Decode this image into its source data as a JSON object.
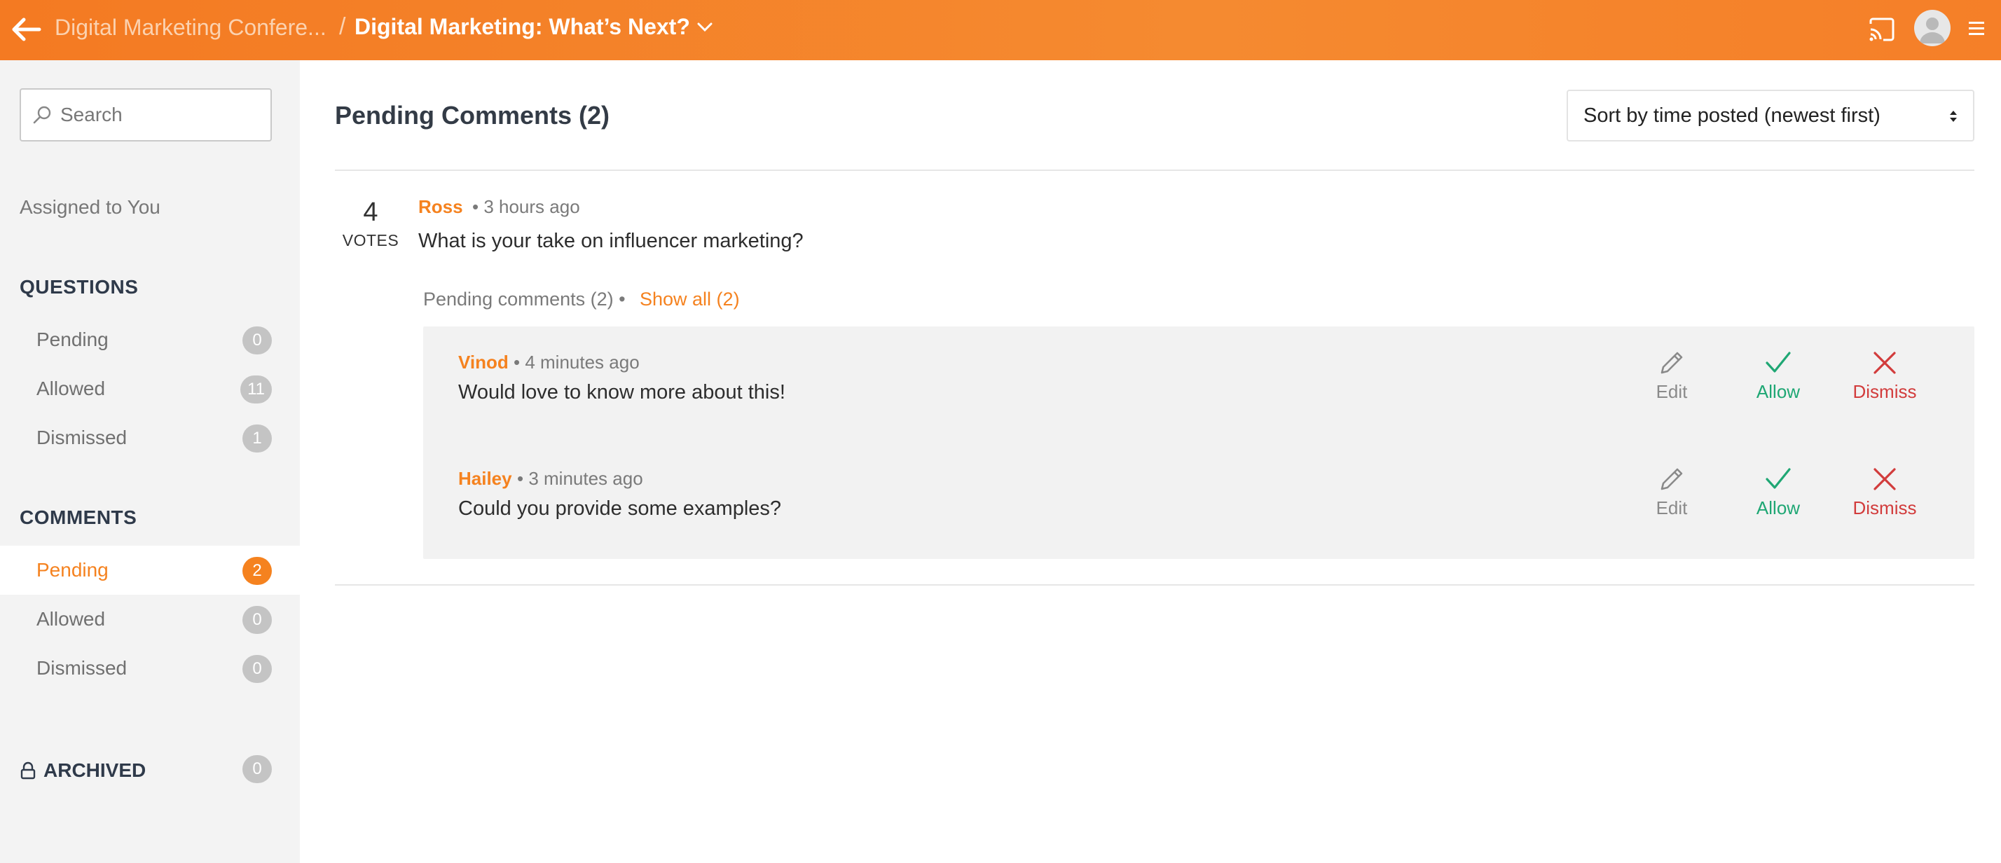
{
  "header": {
    "parent_title": "Digital Marketing Confere...",
    "separator": "/",
    "current_title": "Digital Marketing: What’s Next?"
  },
  "colors": {
    "accent": "#f5821f",
    "allow": "#1fa774",
    "dismiss": "#d23c3c",
    "sidebar_bg": "#f3f3f3",
    "panel_bg": "#f2f2f2"
  },
  "icons": [
    "back-arrow-icon",
    "chevron-down-icon",
    "cast-icon",
    "user-avatar-icon",
    "hamburger-menu-icon",
    "search-icon",
    "lock-icon",
    "pencil-icon",
    "checkmark-icon",
    "close-x-icon",
    "sort-arrows-icon"
  ],
  "sidebar": {
    "search_placeholder": "Search",
    "assigned": "Assigned to You",
    "questions": {
      "title": "QUESTIONS",
      "items": [
        {
          "label": "Pending",
          "count": "0"
        },
        {
          "label": "Allowed",
          "count": "11"
        },
        {
          "label": "Dismissed",
          "count": "1"
        }
      ]
    },
    "comments": {
      "title": "COMMENTS",
      "items": [
        {
          "label": "Pending",
          "count": "2",
          "active": true
        },
        {
          "label": "Allowed",
          "count": "0"
        },
        {
          "label": "Dismissed",
          "count": "0"
        }
      ]
    },
    "archived": {
      "label": "ARCHIVED",
      "count": "0"
    }
  },
  "main": {
    "title": "Pending Comments (2)",
    "sort_label": "Sort by time posted (newest first)",
    "question": {
      "votes": "4",
      "votes_label": "VOTES",
      "author": "Ross",
      "time": "• 3 hours ago",
      "text": "What is your take on influencer marketing?"
    },
    "pending_meta": "Pending comments (2)  •",
    "show_all": "Show all (2)",
    "comments": [
      {
        "author": "Vinod",
        "time": "• 4 minutes ago",
        "text": "Would love to know more about this!"
      },
      {
        "author": "Hailey",
        "time": "• 3 minutes ago",
        "text": "Could you provide some examples?"
      }
    ],
    "actions": {
      "edit": "Edit",
      "allow": "Allow",
      "dismiss": "Dismiss"
    }
  }
}
